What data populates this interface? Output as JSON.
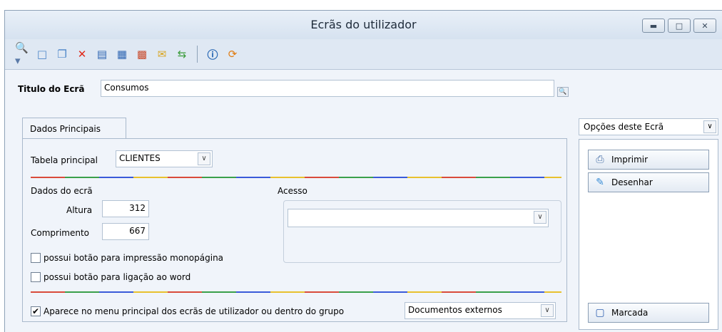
{
  "window": {
    "title": "Ecrãs do utilizador",
    "controls": [
      "minimize",
      "maximize",
      "close"
    ]
  },
  "toolbar": {
    "icons": [
      "search-icon",
      "new-document-icon",
      "copy-document-icon",
      "delete-icon",
      "properties-icon",
      "table-icon",
      "organize-icon",
      "mail-icon",
      "refresh-fields-icon",
      "help-icon",
      "reload-icon"
    ]
  },
  "form": {
    "titulo_label": "Titulo do Ecrã",
    "titulo_value": "Consumos",
    "tab_label": "Dados Principais",
    "tabela_label": "Tabela principal",
    "tabela_value": "CLIENTES",
    "dados_label": "Dados do ecrã",
    "altura_label": "Altura",
    "altura_value": "312",
    "comprimento_label": "Comprimento",
    "comprimento_value": "667",
    "acesso_label": "Acesso",
    "acesso_value": "",
    "chk_monopagina_label": "possui botão para impressão monopágina",
    "chk_monopagina_checked": false,
    "chk_word_label": "possui botão para ligação ao word",
    "chk_word_checked": false,
    "chk_menu_label": "Aparece no menu principal dos ecrãs de utilizador ou dentro do grupo",
    "chk_menu_checked": true,
    "grupo_value": "Documentos externos"
  },
  "side": {
    "options_label": "Opções deste Ecrã",
    "imprimir_label": "Imprimir",
    "desenhar_label": "Desenhar",
    "marcada_label": "Marcada"
  }
}
